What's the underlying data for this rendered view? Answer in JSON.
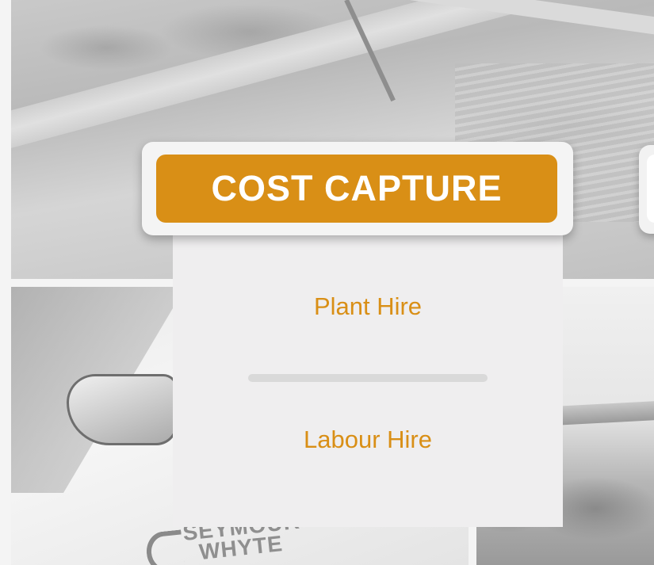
{
  "header": {
    "title": "COST CAPTURE"
  },
  "menu": {
    "items": [
      {
        "label": "Plant Hire"
      },
      {
        "label": "Labour Hire"
      }
    ]
  },
  "background": {
    "logo_text_line1": "SEYMOUR",
    "logo_text_line2": "WHYTE"
  },
  "colors": {
    "accent": "#d98f16",
    "panel": "#efeeef",
    "title_text": "#ffffff"
  }
}
